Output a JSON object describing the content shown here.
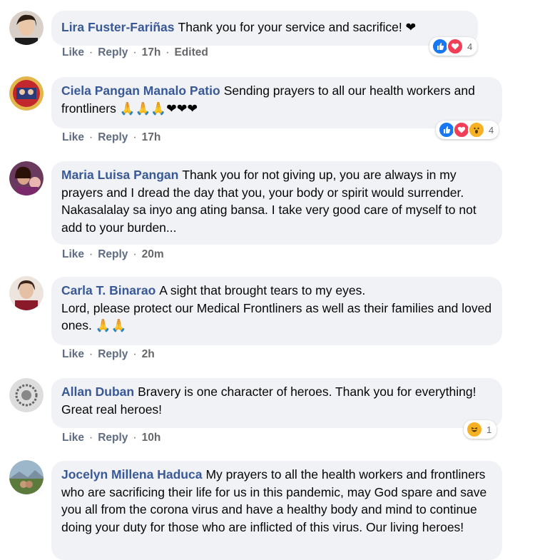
{
  "colors": {
    "author": "#385898",
    "bubble": "#f0f2f5",
    "meta": "#65676b",
    "like": "#1877f2",
    "love": "#f33e58",
    "wow": "#f7b125"
  },
  "actions": {
    "like": "Like",
    "reply": "Reply",
    "separator": "·"
  },
  "comments": [
    {
      "author": "Lira Fuster-Fariñas",
      "text": "Thank you for your service and sacrifice! ❤",
      "time": "17h",
      "edited": "Edited",
      "reactions": {
        "icons": [
          "like",
          "love"
        ],
        "count": "4"
      }
    },
    {
      "author": "Ciela Pangan Manalo Patio",
      "text": "Sending prayers to all our health workers and frontliners 🙏🙏🙏❤❤❤",
      "time": "17h",
      "reactions": {
        "icons": [
          "like",
          "love",
          "wow"
        ],
        "count": "4"
      }
    },
    {
      "author": "Maria Luisa Pangan",
      "text": "Thank you for not giving up, you are always in my prayers and I dread the day that you, your body or spirit would surrender. Nakasalalay sa inyo ang ating bansa. I take very good care of myself to not add to your burden...",
      "time": "20m"
    },
    {
      "author": "Carla T. Binarao",
      "text": "A sight that brought tears to my eyes.\nLord, please protect our Medical Frontliners as well as their families and loved ones. 🙏🙏",
      "time": "2h"
    },
    {
      "author": "Allan Duban",
      "text": "Bravery is one character of heroes. Thank you for everything! Great real heroes!",
      "time": "10h",
      "reactions": {
        "icons": [
          "haha"
        ],
        "count": "1"
      }
    },
    {
      "author": "Jocelyn Millena Haduca",
      "text": "My prayers to all the health workers and frontliners who are sacrificing their life for us in this pandemic, may God spare and save you all from the corona virus and have a healthy body and mind to continue doing your duty for those who are inflicted of this virus. Our living heroes!",
      "time": ""
    }
  ]
}
